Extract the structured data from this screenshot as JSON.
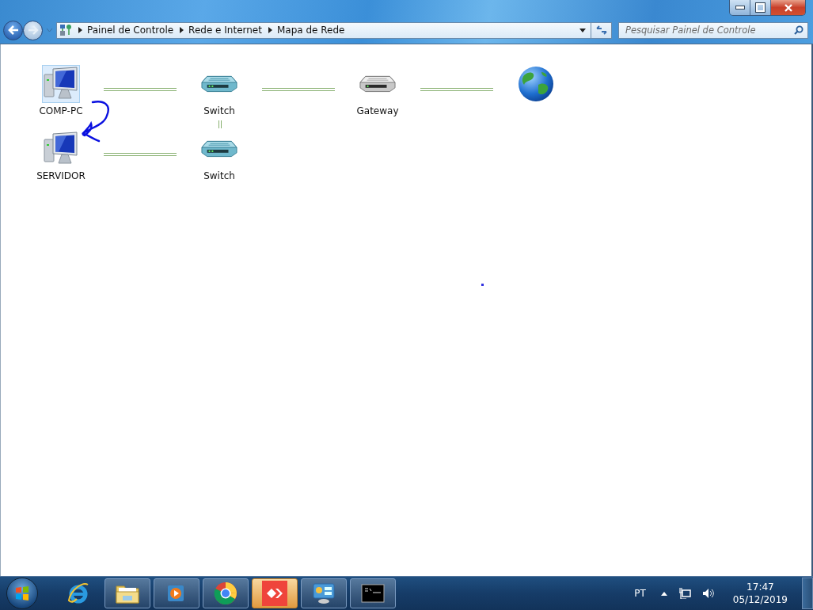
{
  "window": {
    "controls": [
      {
        "kind": "minimize"
      },
      {
        "kind": "restore"
      },
      {
        "kind": "close"
      }
    ]
  },
  "address_bar": {
    "breadcrumbs": [
      "Painel de Controle",
      "Rede e Internet",
      "Mapa de Rede"
    ]
  },
  "search": {
    "placeholder": "Pesquisar Painel de Controle"
  },
  "network_map": {
    "rows": [
      {
        "nodes": [
          {
            "label": "COMP-PC",
            "kind": "computer",
            "selected": true
          },
          {
            "label": "Switch",
            "kind": "switch",
            "selected": false,
            "link_below": true
          },
          {
            "label": "Gateway",
            "kind": "gateway",
            "selected": false
          },
          {
            "kind": "internet",
            "selected": false
          }
        ]
      },
      {
        "nodes": [
          {
            "label": "SERVIDOR",
            "kind": "computer",
            "selected": false
          },
          {
            "label": "Switch",
            "kind": "switch",
            "selected": false
          }
        ]
      }
    ]
  },
  "taskbar": {
    "buttons": [
      {
        "kind": "ie",
        "running": false,
        "active": false
      },
      {
        "kind": "explorer",
        "running": true,
        "active": false
      },
      {
        "kind": "media",
        "running": true,
        "active": false
      },
      {
        "kind": "chrome",
        "running": true,
        "active": false
      },
      {
        "kind": "anydesk",
        "running": true,
        "active": true
      },
      {
        "kind": "control-panel",
        "running": true,
        "active": false
      },
      {
        "kind": "cmd",
        "running": true,
        "active": false
      }
    ],
    "language": "PT",
    "time": "17:47",
    "date": "05/12/2019"
  }
}
